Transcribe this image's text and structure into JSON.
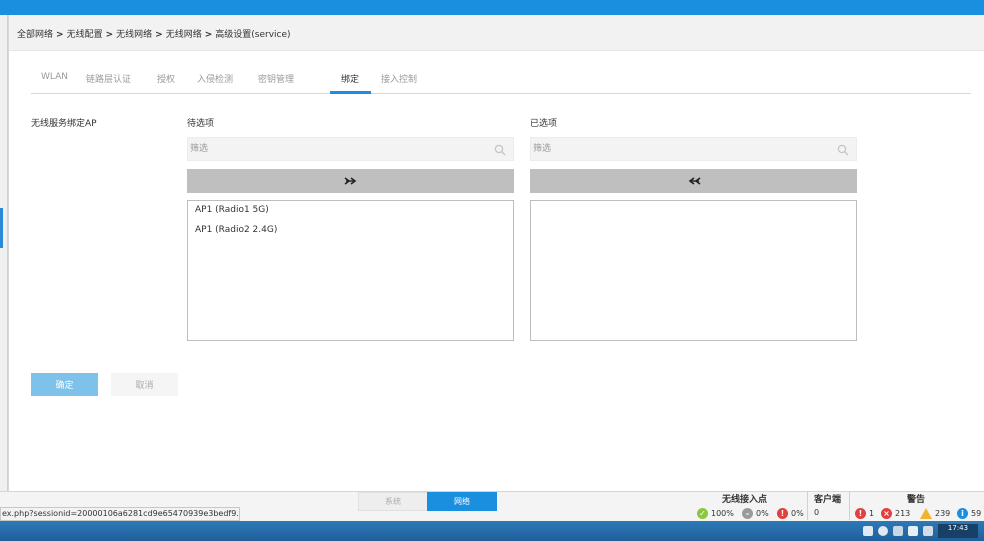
{
  "breadcrumb": {
    "items": [
      "全部网络",
      "无线配置",
      "无线网络",
      "无线网络",
      "高级设置(service)"
    ],
    "separator": ">"
  },
  "tabs": [
    {
      "label": "WLAN",
      "active": false
    },
    {
      "label": "链路层认证",
      "active": false
    },
    {
      "label": "授权",
      "active": false
    },
    {
      "label": "入侵检测",
      "active": false
    },
    {
      "label": "密钥管理",
      "active": false
    },
    {
      "label": "绑定",
      "active": true
    },
    {
      "label": "接入控制",
      "active": false
    }
  ],
  "binding": {
    "field_label": "无线服务绑定AP",
    "available": {
      "title": "待选项",
      "filter_placeholder": "筛选",
      "move_icon": "double-arrow-right-icon",
      "items": [
        "AP1 (Radio1 5G)",
        "AP1 (Radio2 2.4G)"
      ]
    },
    "selected": {
      "title": "已选项",
      "filter_placeholder": "筛选",
      "move_icon": "double-arrow-left-icon",
      "items": []
    }
  },
  "actions": {
    "confirm_label": "确定",
    "cancel_label": "取消"
  },
  "bottom_tabs": {
    "system_label": "系统",
    "network_label": "网络",
    "active": "network"
  },
  "status": {
    "ap": {
      "title": "无线接入点",
      "online_pct": "100%",
      "offline_pct": "0%",
      "fault_pct": "0%"
    },
    "clients": {
      "title": "客户端",
      "count": "0"
    },
    "alarms": {
      "title": "警告",
      "critical": "1",
      "major": "213",
      "minor": "239",
      "info": "59"
    }
  },
  "status_url": "ex.php?sessionid=20000106a6281cd9e65470939e3bedf9...",
  "taskbar": {
    "time": "17:43"
  },
  "colors": {
    "accent": "#1a8fe0",
    "confirm_disabled": "#7ec2ec",
    "ok": "#8cc63f",
    "error": "#e04040",
    "warn": "#f0b431",
    "info": "#1a8fe0"
  }
}
